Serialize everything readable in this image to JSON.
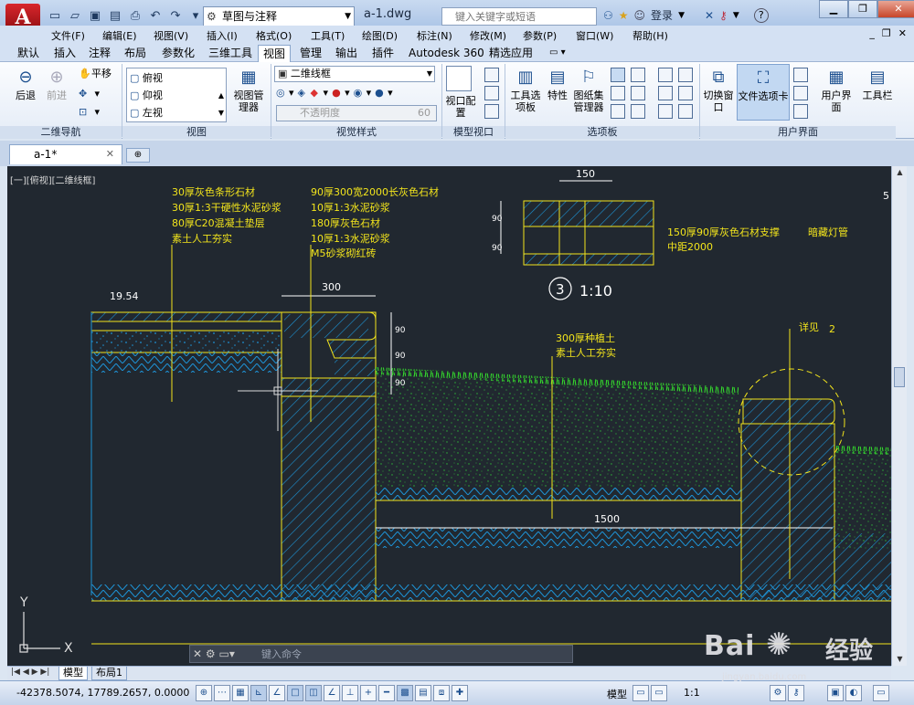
{
  "app": {
    "logo_letter": "A",
    "workspace": "草图与注释",
    "document_title": "a-1.dwg",
    "search_placeholder": "键入关键字或短语",
    "login_label": "登录"
  },
  "menu": [
    "文件(F)",
    "编辑(E)",
    "视图(V)",
    "插入(I)",
    "格式(O)",
    "工具(T)",
    "绘图(D)",
    "标注(N)",
    "修改(M)",
    "参数(P)",
    "窗口(W)",
    "帮助(H)"
  ],
  "ribbon_tabs": [
    "默认",
    "插入",
    "注释",
    "布局",
    "参数化",
    "三维工具",
    "视图",
    "管理",
    "输出",
    "插件",
    "Autodesk 360",
    "精选应用"
  ],
  "active_ribbon_tab": "视图",
  "ribbon": {
    "nav2d": {
      "title": "二维导航",
      "back": "后退",
      "forward": "前进",
      "pan": "平移"
    },
    "views": {
      "title": "视图",
      "items": [
        "俯视",
        "仰视",
        "左视"
      ],
      "manager": "视图管理器"
    },
    "visual_styles": {
      "title": "视觉样式",
      "style": "二维线框",
      "opacity_label": "不透明度",
      "opacity_value": "60"
    },
    "model_viewports": {
      "title": "模型视口",
      "config_label": "视口配置"
    },
    "palettes": {
      "title": "选项板",
      "tool_palettes": "工具选项板",
      "properties": "特性",
      "sheet_set": "图纸集管理器"
    },
    "ui": {
      "title": "用户界面",
      "switch_windows": "切换窗口",
      "file_tabs": "文件选项卡",
      "user_interface": "用户界面",
      "toolbars": "工具栏"
    }
  },
  "file_tab": {
    "name": "a-1*"
  },
  "viewport_label": "[一][俯视][二维线框]",
  "drawing": {
    "notes": {
      "left_stack": [
        "30厚灰色条形石材",
        "30厚1:3干硬性水泥砂浆",
        "80厚C20混凝土垫层",
        "素土人工夯实"
      ],
      "mid_stack": [
        "90厚300宽2000长灰色石材",
        "10厚1:3水泥砂浆",
        "180厚灰色石材",
        "10厚1:3水泥砂浆",
        "M5砂浆砌红砖"
      ],
      "right_stack": [
        "300厚种植土",
        "素土人工夯实"
      ],
      "support": [
        "150厚90厚灰色石材支撑",
        "中距2000"
      ],
      "lamp": "暗藏灯管",
      "detail_ref": "详见",
      "detail_ref_num": "2",
      "section_num": "3",
      "section_scale": "1:10"
    },
    "dims": {
      "d300": "300",
      "d150": "150",
      "d1500": "1500",
      "d90a": "90",
      "d90b": "90",
      "d90c": "90",
      "d90d": "90",
      "d90e": "90",
      "elev": "19.54",
      "partial": "5"
    },
    "axis_x": "X",
    "axis_y": "Y"
  },
  "command_line": {
    "prompt_placeholder": "键入命令"
  },
  "layout_tabs": [
    "模型",
    "布局1"
  ],
  "status": {
    "coords": "-42378.5074, 17789.2657, 0.0000",
    "model": "模型",
    "scale": "1:1"
  },
  "watermark": {
    "brand": "Bai",
    "brand2": "经验",
    "url": "jingyan.baidu.com"
  },
  "colors": {
    "canvas": "#212830",
    "annot": "#f2e41c",
    "hatch": "#1d93d6",
    "grass": "#34e22c",
    "dim": "#ffffff"
  }
}
